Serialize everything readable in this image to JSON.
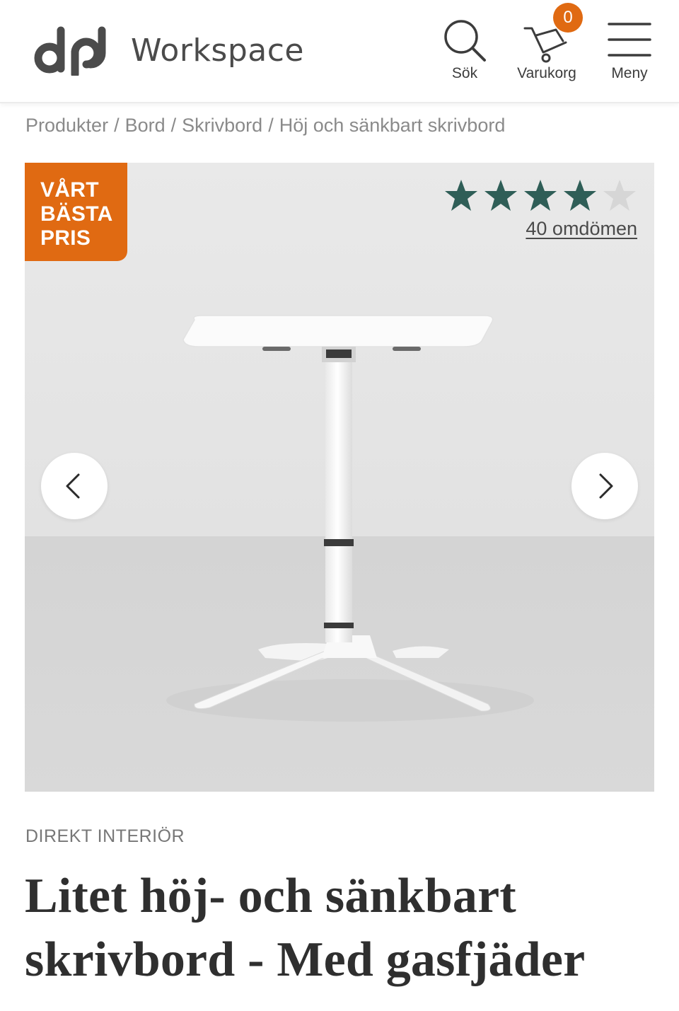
{
  "header": {
    "logo_text": "Workspace",
    "search_label": "Sök",
    "cart_label": "Varukorg",
    "cart_count": "0",
    "menu_label": "Meny"
  },
  "breadcrumb": {
    "items": [
      "Produkter",
      "Bord",
      "Skrivbord",
      "Höj och sänkbart skrivbord"
    ],
    "separator": "/"
  },
  "gallery": {
    "badge_line1": "VÅRT",
    "badge_line2": "BÄSTA",
    "badge_line3": "PRIS",
    "rating_stars_filled": 4,
    "rating_stars_total": 5,
    "reviews_text": "40 omdömen"
  },
  "product": {
    "brand": "DIREKT INTERIÖR",
    "title": "Litet höj- och sänkbart skrivbord - Med gasfjäder"
  },
  "colors": {
    "accent_orange": "#e06a12",
    "star_green": "#2f5e57",
    "star_empty": "#d6d6d6"
  }
}
